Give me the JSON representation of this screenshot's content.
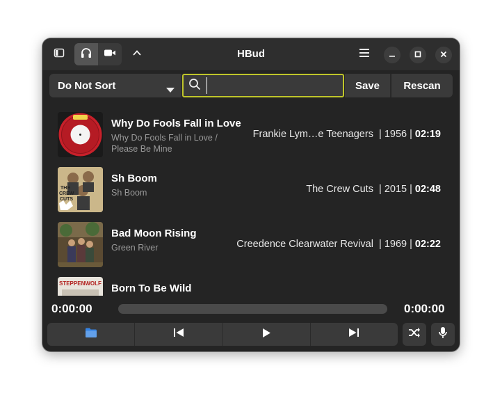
{
  "app": {
    "title": "HBud"
  },
  "header": {
    "sidebar_toggle_icon": "sidebar-icon",
    "audio_mode_icon": "headphones-icon",
    "video_mode_icon": "video-camera-icon",
    "collapse_icon": "chevron-up-icon",
    "menu_icon": "hamburger-menu-icon",
    "window_controls": [
      "minimize-icon",
      "maximize-icon",
      "close-icon"
    ]
  },
  "toolbar": {
    "sort_value": "Do Not Sort",
    "search_value": "",
    "save_label": "Save",
    "rescan_label": "Rescan"
  },
  "tracks": [
    {
      "title": "Why Do Fools Fall in Love",
      "album": "Why Do Fools Fall in Love / Please Be Mine",
      "artist": "Frankie Lym…e Teenagers",
      "year": "1956",
      "duration": "02:19"
    },
    {
      "title": "Sh Boom",
      "album": "Sh Boom",
      "artist": "The Crew Cuts",
      "year": "2015",
      "duration": "02:48"
    },
    {
      "title": "Bad Moon Rising",
      "album": "Green River",
      "artist": "Creedence Clearwater Revival",
      "year": "1969",
      "duration": "02:22"
    },
    {
      "title": "Born To Be Wild",
      "album": "",
      "artist": "",
      "year": "",
      "duration": ""
    }
  ],
  "player": {
    "current_time": "0:00:00",
    "total_time": "0:00:00",
    "progress": 0,
    "accent": "#bfc52a",
    "folder_color": "#3584e4"
  }
}
